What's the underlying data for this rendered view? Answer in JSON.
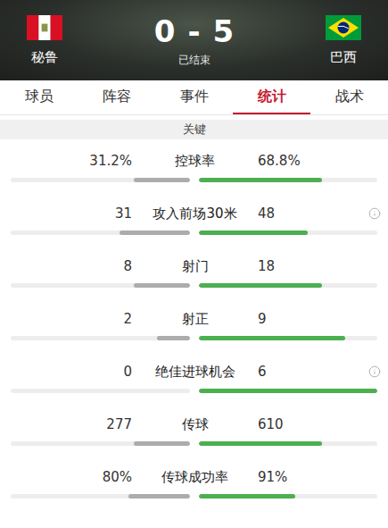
{
  "match": {
    "home": {
      "name": "秘鲁",
      "score": "0"
    },
    "away": {
      "name": "巴西",
      "score": "5"
    },
    "separator": "-",
    "status": "已结束"
  },
  "tabs": [
    {
      "label": "球员",
      "selected": false
    },
    {
      "label": "阵容",
      "selected": false
    },
    {
      "label": "事件",
      "selected": false
    },
    {
      "label": "统计",
      "selected": true
    },
    {
      "label": "战术",
      "selected": false
    }
  ],
  "section": {
    "title": "关键"
  },
  "stats": [
    {
      "label": "控球率",
      "home": "31.2%",
      "away": "68.8%",
      "home_level": 0.31,
      "away_level": 0.69,
      "info": false
    },
    {
      "label": "攻入前场30米",
      "home": "31",
      "away": "48",
      "home_level": 0.39,
      "away_level": 0.61,
      "info": true
    },
    {
      "label": "射门",
      "home": "8",
      "away": "18",
      "home_level": 0.31,
      "away_level": 0.69,
      "info": false
    },
    {
      "label": "射正",
      "home": "2",
      "away": "9",
      "home_level": 0.18,
      "away_level": 0.82,
      "info": false
    },
    {
      "label": "绝佳进球机会",
      "home": "0",
      "away": "6",
      "home_level": 0,
      "away_level": 1,
      "info": true
    },
    {
      "label": "传球",
      "home": "277",
      "away": "610",
      "home_level": 0.31,
      "away_level": 0.69,
      "info": false
    },
    {
      "label": "传球成功率",
      "home": "80%",
      "away": "91%",
      "home_level": 0.34,
      "away_level": 0.54,
      "info": false
    }
  ]
}
